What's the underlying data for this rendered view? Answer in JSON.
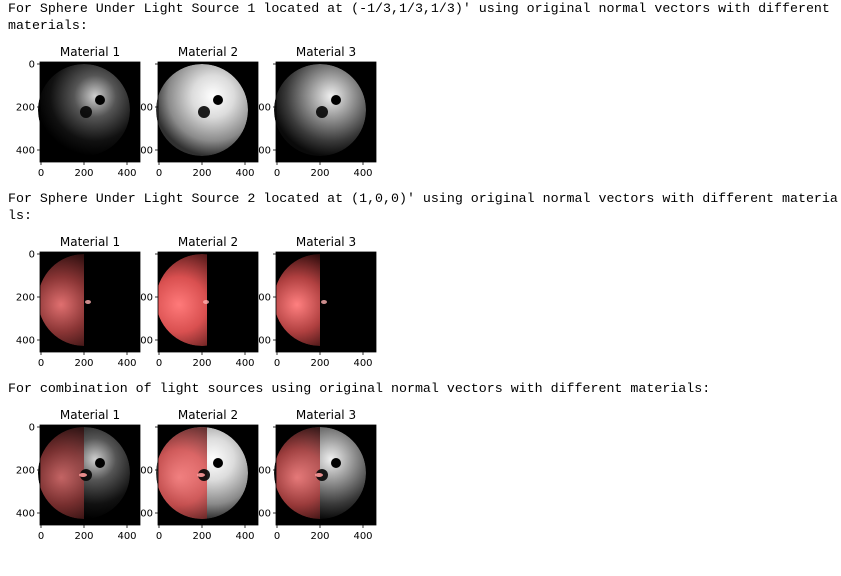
{
  "sections": [
    {
      "caption": "For Sphere Under Light Source 1 located at (-1/3,1/3,1/3)' using original normal vectors with different materials:",
      "panels": [
        {
          "title": "Material 1",
          "light": "source1",
          "material": 1
        },
        {
          "title": "Material 2",
          "light": "source1",
          "material": 2
        },
        {
          "title": "Material 3",
          "light": "source1",
          "material": 3
        }
      ]
    },
    {
      "caption": "For Sphere Under Light Source 2 located at (1,0,0)' using original normal vectors with different materials:",
      "panels": [
        {
          "title": "Material 1",
          "light": "source2",
          "material": 1
        },
        {
          "title": "Material 2",
          "light": "source2",
          "material": 2
        },
        {
          "title": "Material 3",
          "light": "source2",
          "material": 3
        }
      ]
    },
    {
      "caption": "For combination of light sources using original normal vectors with different materials:",
      "panels": [
        {
          "title": "Material 1",
          "light": "combined",
          "material": 1
        },
        {
          "title": "Material 2",
          "light": "combined",
          "material": 2
        },
        {
          "title": "Material 3",
          "light": "combined",
          "material": 3
        }
      ]
    }
  ],
  "axes": {
    "x_ticks": [
      "0",
      "200",
      "400"
    ],
    "y_ticks": [
      "0",
      "200",
      "400"
    ],
    "y_ticks_clipped": [
      "",
      "00",
      "00"
    ]
  },
  "colors": {
    "source1": "#ffffff",
    "source2": "#ff6a6a",
    "background": "#000000"
  }
}
